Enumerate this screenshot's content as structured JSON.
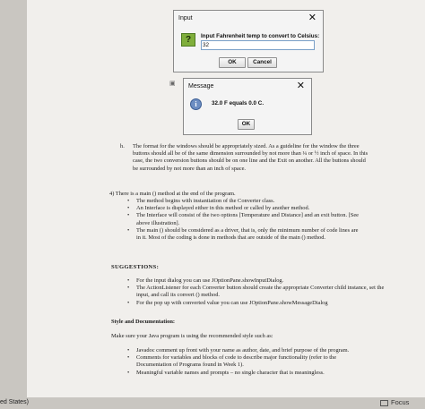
{
  "input_dialog": {
    "title": "Input",
    "close": "✕",
    "prompt": "Input Fahrenheit temp to convert to Celsius:",
    "value": "32",
    "ok": "OK",
    "cancel": "Cancel",
    "icon": "question-icon"
  },
  "message_dialog": {
    "title": "Message",
    "close": "✕",
    "message": "32.0 F equals 0.0 C.",
    "ok": "OK",
    "icon": "info-icon"
  },
  "doc": {
    "h_label": "h.",
    "h_text": "The format for the windows should be appropriately sized. As a guideline for the window the three buttons should all be of the same dimension surrounded by not more than ¼ or ½ inch of space. In this case, the two conversion buttons should be on one line and the Exit on another. All the buttons should be surrounded by not more than an inch of space.",
    "sec4_title": "4) There is a main () method at the end of the program.",
    "sec4_bullets": [
      "The method begins with instantiation of the Converter class.",
      "An Interface is displayed either in this method or called by another method.",
      "The Interface will consist of the two options [Temperature and Distance] and an exit button. [See above illustration].",
      "The main () should be considered as a driver, that is, only the minimum number of code lines are in it. Most of the coding is done in methods that are outside of the main () method."
    ],
    "suggestions_title": "SUGGESTIONS:",
    "suggestions": [
      "For the input dialog you can use JOptionPane.showInputDialog.",
      "The ActionListener for each Converter button should create the appropriate Converter child instance, set the input, and call its convert () method.",
      "For the pop up with converted value you can use JOptionPane.showMessageDialog"
    ],
    "style_title": "Style and Documentation:",
    "style_intro": "Make sure your Java program is using the recommended style such as:",
    "style_bullets": [
      "Javadoc comment up front with your name as author, date, and brief purpose of the program.",
      "Comments for variables and blocks of code to describe major functionality (refer to the Documentation of Programs found in Week 1).",
      "Meaningful variable names and prompts – no single character that is meaningless."
    ]
  },
  "taskbar": {
    "left_text": "ed States)",
    "focus": "Focus"
  }
}
